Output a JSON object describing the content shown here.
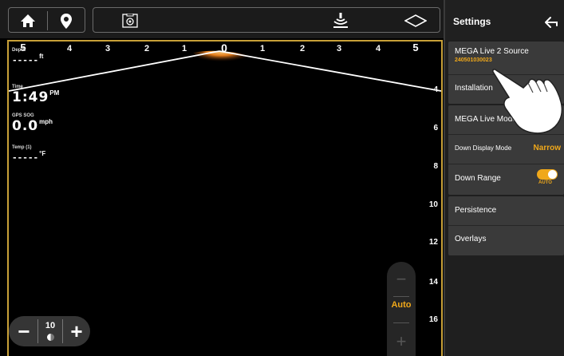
{
  "topbar": {
    "icons": [
      "home-icon",
      "waypoint-pin-icon",
      "screenshot-camera-icon",
      "sonar-ping-icon",
      "view-diamond-icon"
    ]
  },
  "sonar": {
    "horizontal_scale": [
      "5",
      "4",
      "3",
      "2",
      "1",
      "0",
      "1",
      "2",
      "3",
      "4",
      "5"
    ],
    "depth_scale": [
      "4",
      "6",
      "8",
      "10",
      "12",
      "14",
      "16"
    ],
    "readouts": {
      "depth": {
        "label": "Depth",
        "value": "-----",
        "unit": "ft"
      },
      "time": {
        "label": "Time",
        "value": "1:49",
        "unit": "PM"
      },
      "speed": {
        "label": "GPS SOG",
        "value": "0.0",
        "unit": "mph"
      },
      "temp": {
        "label": "Temp (1)",
        "value": "-----",
        "unit": "°F"
      }
    },
    "zoom": {
      "minus": "−",
      "value": "10",
      "plus": "+"
    },
    "range": {
      "minus": "−",
      "mode": "Auto",
      "plus": "+"
    },
    "colors": {
      "frame": "#c8a038",
      "accent": "#f0a81a"
    }
  },
  "settings": {
    "title": "Settings",
    "items": [
      {
        "label": "MEGA Live 2 Source",
        "sub": "240501030023"
      },
      {
        "label": "Installation"
      },
      {
        "label": "MEGA Live Mode"
      },
      {
        "label": "Down Display Mode",
        "value": "Narrow"
      },
      {
        "label": "Down Range",
        "toggle": "AUTO"
      },
      {
        "label": "Persistence"
      },
      {
        "label": "Overlays"
      }
    ]
  }
}
